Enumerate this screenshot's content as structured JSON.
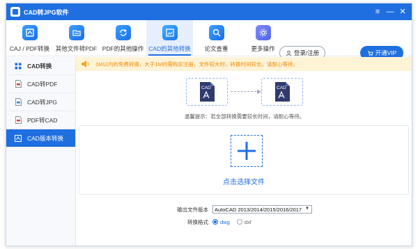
{
  "app": {
    "title": "CAD转JPG软件"
  },
  "window_controls": {
    "menu": "≡",
    "minimize": "—",
    "close": "✕"
  },
  "toolbar": {
    "tools": [
      {
        "label": "CAJ / PDF转换",
        "icon": "caj-pdf-icon"
      },
      {
        "label": "其他文件转PDF",
        "icon": "folder-icon"
      },
      {
        "label": "PDF的其他操作",
        "icon": "refresh-icon"
      },
      {
        "label": "CAD的其他转换",
        "icon": "image-frame-icon",
        "active": true
      },
      {
        "label": "论文查重",
        "icon": "magnifier-icon"
      },
      {
        "label": "更多操作",
        "icon": "gear-icon"
      }
    ],
    "login_label": "登录/注册",
    "vip_label": "开通VIP"
  },
  "sidebar": {
    "items": [
      {
        "label": "CAD转换",
        "icon": "grid-icon"
      },
      {
        "label": "CAD转PDF",
        "icon": "pdf-file-icon"
      },
      {
        "label": "CAD转JPG",
        "icon": "jpg-file-icon"
      },
      {
        "label": "PDF转CAD",
        "icon": "cad-file-icon"
      },
      {
        "label": "CAD版本转换",
        "icon": "version-icon",
        "active": true
      }
    ]
  },
  "notice": {
    "text": "1M以内的免费转换，大于1M的需购买注册，文件较大时，转换时间较长，请耐心等待。"
  },
  "conversion": {
    "source_badge": "CAD",
    "target_badge": "CAD",
    "hint": "温馨提示：若全部转换需要较长时间，请耐心等待。"
  },
  "dropzone": {
    "label": "点击选择文件"
  },
  "options": {
    "version_label": "输出文件版本",
    "version_value": "AutoCAD 2013/2014/2015/2016/2017",
    "format_label": "转换格式",
    "formats": [
      {
        "label": "dwg",
        "selected": true
      },
      {
        "label": "dxf",
        "selected": false
      }
    ]
  },
  "colors": {
    "accent": "#1f6fe0",
    "notice_bg": "#fff3d6",
    "notice_text": "#f08a00"
  }
}
